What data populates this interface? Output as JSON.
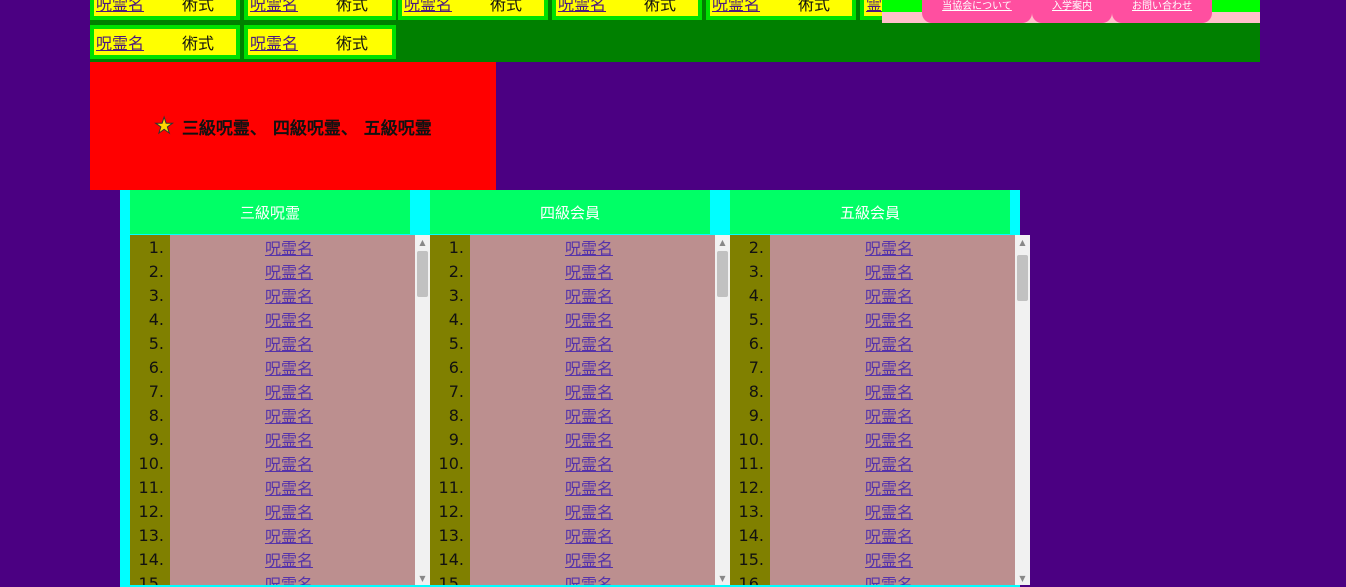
{
  "cards": [
    {
      "name": "呪霊名",
      "technique": "術式"
    },
    {
      "name": "呪霊名",
      "technique": "術式"
    },
    {
      "name": "呪霊名",
      "technique": "術式"
    },
    {
      "name": "呪霊名",
      "technique": "術式"
    },
    {
      "name": "呪霊名",
      "technique": "術式"
    },
    {
      "name": "呪霊名",
      "technique": "術式"
    },
    {
      "name": "呪霊名",
      "technique": "術式"
    },
    {
      "name": "呪霊名",
      "technique": "術式"
    }
  ],
  "nav": {
    "items": [
      "当協会について",
      "入学案内",
      "お問い合わせ"
    ]
  },
  "heading": {
    "icon": "star-icon",
    "text": "三級呪霊、 四級呪霊、 五級呪霊"
  },
  "columns": [
    {
      "title": "三級呪霊",
      "start": 1,
      "items": [
        "呪霊名",
        "呪霊名",
        "呪霊名",
        "呪霊名",
        "呪霊名",
        "呪霊名",
        "呪霊名",
        "呪霊名",
        "呪霊名",
        "呪霊名",
        "呪霊名",
        "呪霊名",
        "呪霊名",
        "呪霊名",
        "呪霊名"
      ]
    },
    {
      "title": "四級会員",
      "start": 1,
      "items": [
        "呪霊名",
        "呪霊名",
        "呪霊名",
        "呪霊名",
        "呪霊名",
        "呪霊名",
        "呪霊名",
        "呪霊名",
        "呪霊名",
        "呪霊名",
        "呪霊名",
        "呪霊名",
        "呪霊名",
        "呪霊名",
        "呪霊名"
      ]
    },
    {
      "title": "五級会員",
      "start": 2,
      "items": [
        "呪霊名",
        "呪霊名",
        "呪霊名",
        "呪霊名",
        "呪霊名",
        "呪霊名",
        "呪霊名",
        "呪霊名",
        "呪霊名",
        "呪霊名",
        "呪霊名",
        "呪霊名",
        "呪霊名",
        "呪霊名",
        "呪霊名"
      ]
    }
  ],
  "colors": {
    "background": "#4b0082",
    "band": "#008000",
    "card_border": "#00e000",
    "card_fill": "#ffff00",
    "heading_bg": "#ff0000",
    "panel": "#00ffff",
    "column_head": "#00ff66",
    "list_bg": "#bc8f8f",
    "number_bg": "#808000",
    "nav_tab": "#ff4fa0"
  }
}
